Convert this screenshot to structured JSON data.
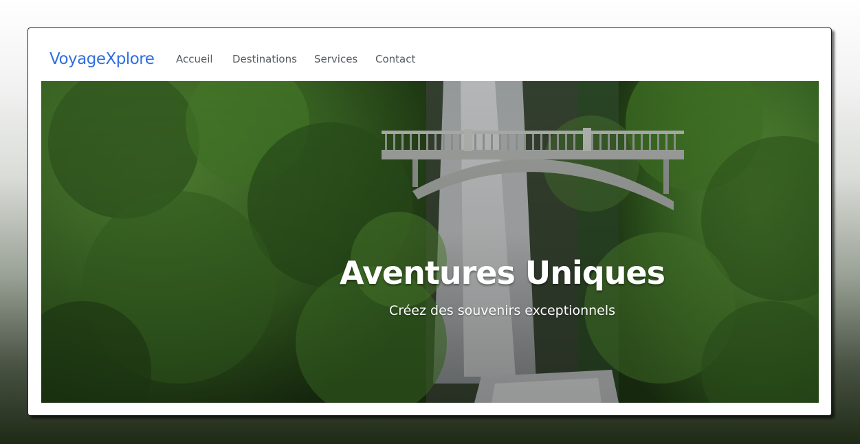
{
  "navbar": {
    "brand": "VoyageXplore",
    "links": [
      {
        "label": "Accueil"
      },
      {
        "label": "Destinations"
      },
      {
        "label": "Services"
      },
      {
        "label": "Contact"
      }
    ]
  },
  "hero": {
    "title": "Aventures Uniques",
    "subtitle": "Créez des souvenirs exceptionnels",
    "image": "waterfall-bridge-forest-photo"
  },
  "colors": {
    "brand": "#2f6fe0",
    "nav_text": "#555b61",
    "hero_text": "#ffffff"
  }
}
